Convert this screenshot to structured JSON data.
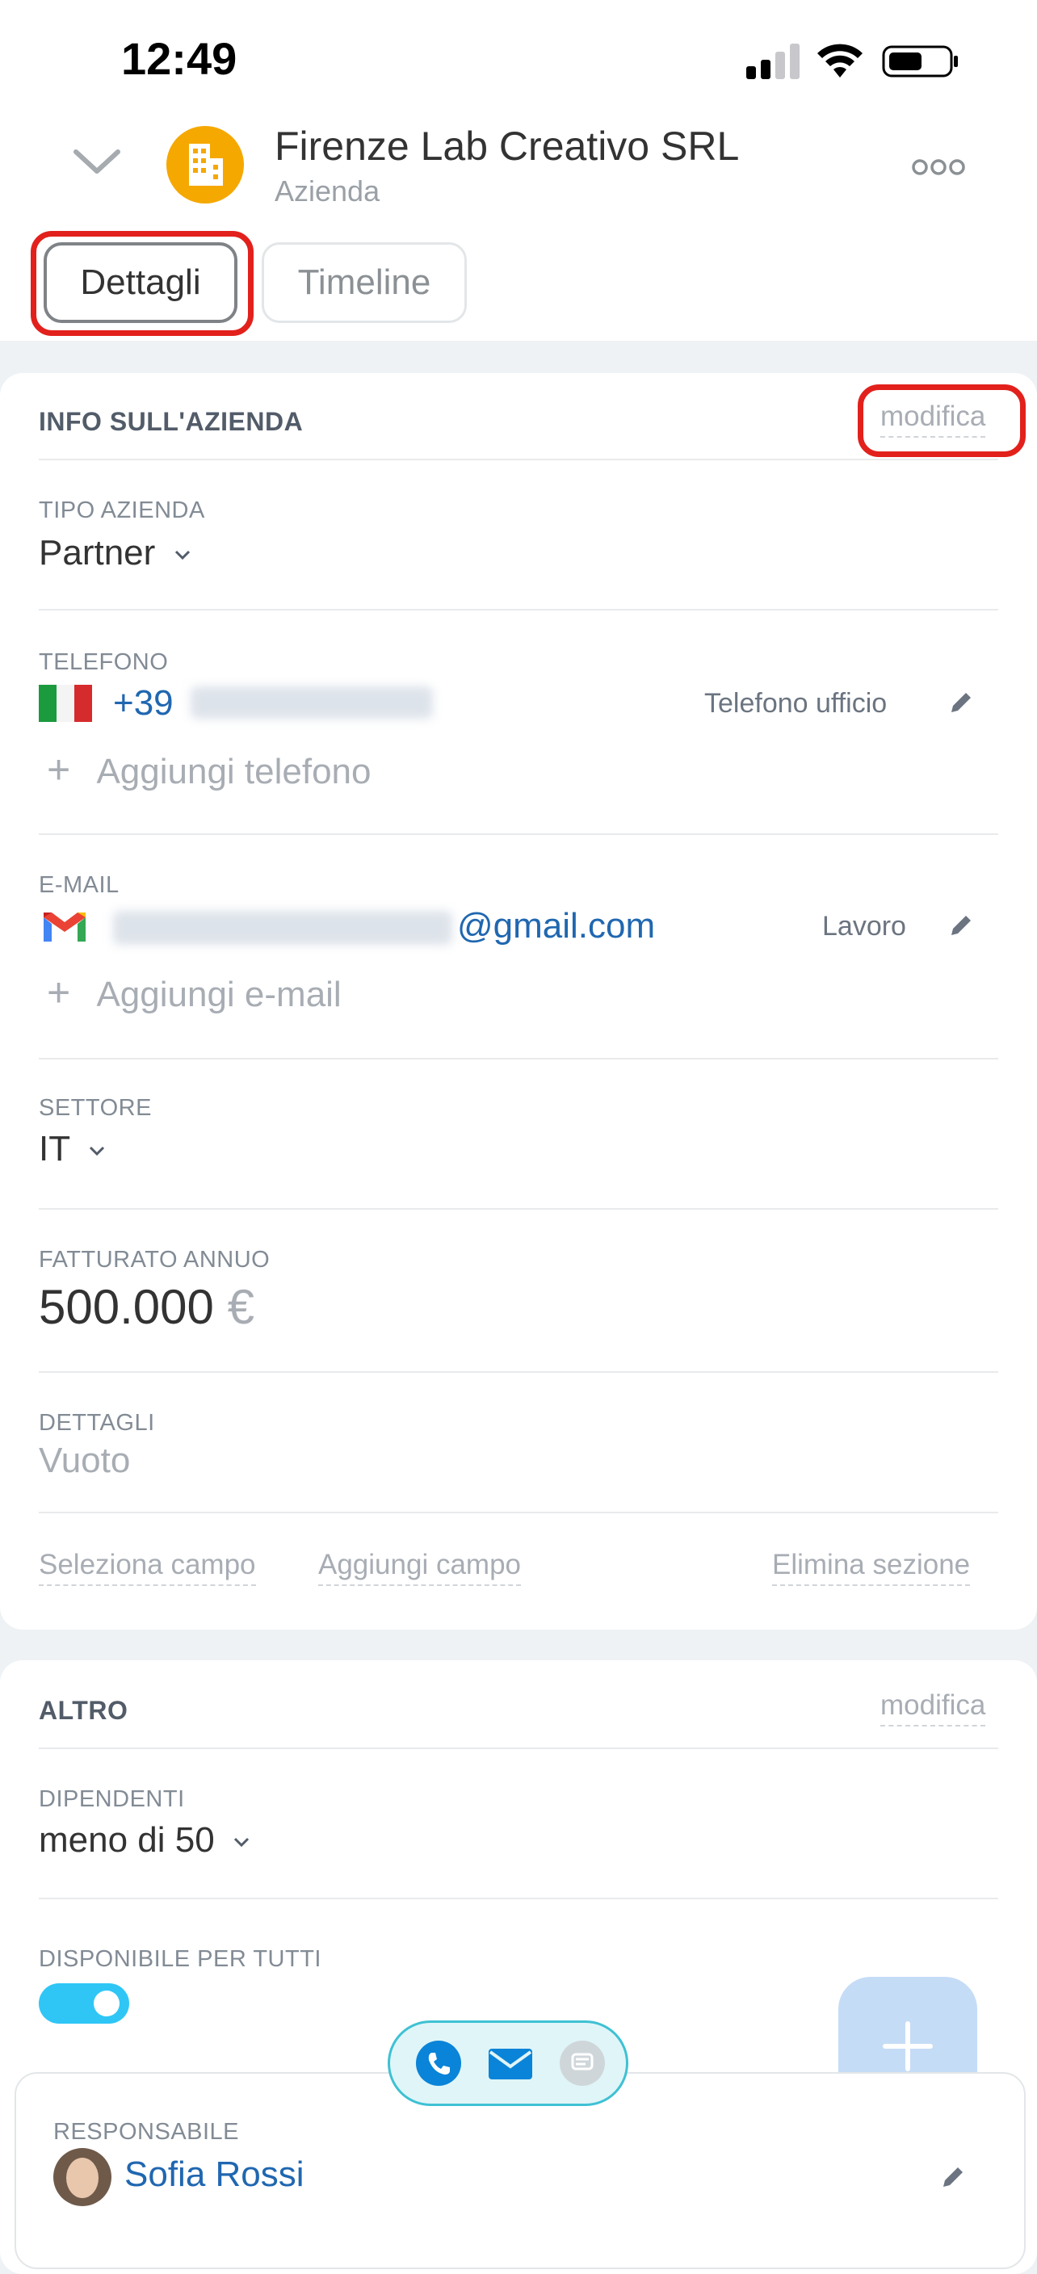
{
  "status_bar": {
    "time": "12:49"
  },
  "header": {
    "title": "Firenze Lab Creativo SRL",
    "subtitle": "Azienda"
  },
  "tabs": [
    {
      "label": "Dettagli"
    },
    {
      "label": "Timeline"
    }
  ],
  "info_section": {
    "title": "INFO SULL'AZIENDA",
    "edit_label": "modifica",
    "tipo_azienda": {
      "label": "TIPO AZIENDA",
      "value": "Partner"
    },
    "telefono": {
      "label": "TELEFONO",
      "prefix": "+39",
      "type": "Telefono ufficio",
      "add_label": "Aggiungi telefono"
    },
    "email": {
      "label": "E-MAIL",
      "domain": "@gmail.com",
      "type": "Lavoro",
      "add_label": "Aggiungi e-mail"
    },
    "settore": {
      "label": "SETTORE",
      "value": "IT"
    },
    "fatturato": {
      "label": "FATTURATO ANNUO",
      "value": "500.000",
      "currency": "€"
    },
    "dettagli": {
      "label": "DETTAGLI",
      "value": "Vuoto"
    },
    "footer": {
      "select_field": "Seleziona campo",
      "add_field": "Aggiungi campo",
      "delete_section": "Elimina sezione"
    }
  },
  "other_section": {
    "title": "ALTRO",
    "edit_label": "modifica",
    "dipendenti": {
      "label": "DIPENDENTI",
      "value": "meno di 50"
    },
    "disponibile": {
      "label": "DISPONIBILE PER TUTTI",
      "enabled": true
    }
  },
  "responsabile": {
    "label": "RESPONSABILE",
    "name": "Sofia Rossi"
  },
  "colors": {
    "accent_blue": "#2067b0",
    "company_avatar": "#f5a800",
    "highlight_red": "#e2211c",
    "toggle_on": "#2fc6f6"
  },
  "icons": [
    "chevron-down-icon",
    "building-icon",
    "more-icon",
    "italy-flag-icon",
    "gmail-icon",
    "pencil-icon",
    "plus-icon",
    "phone-icon",
    "mail-icon",
    "chat-icon"
  ]
}
